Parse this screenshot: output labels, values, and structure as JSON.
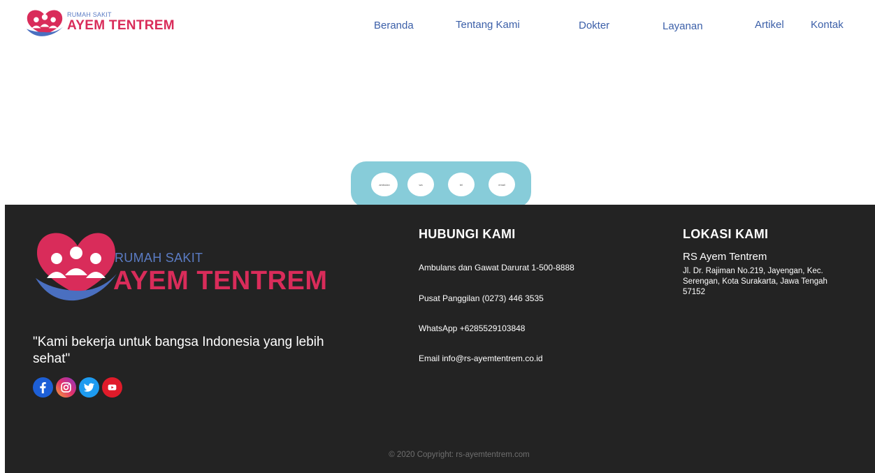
{
  "header": {
    "brand_small": "RUMAH SAKIT",
    "brand_big": "AYEM TENTREM"
  },
  "nav": {
    "items": [
      {
        "label": "Beranda"
      },
      {
        "label": "Tentang Kami"
      },
      {
        "label": "Dokter"
      },
      {
        "label": "Layanan"
      },
      {
        "label": "Artikel"
      },
      {
        "label": "Kontak"
      }
    ]
  },
  "pill": {
    "buttons": [
      {
        "label": "ambulan"
      },
      {
        "label": "wa"
      },
      {
        "label": "tel"
      },
      {
        "label": "email"
      }
    ]
  },
  "footer": {
    "brand_small": "RUMAH SAKIT",
    "brand_big": "AYEM TENTREM",
    "quote": "\"Kami bekerja untuk bangsa Indonesia yang lebih sehat\"",
    "socials": [
      "facebook-icon",
      "instagram-icon",
      "twitter-icon",
      "youtube-icon"
    ],
    "contact": {
      "title": "HUBUNGI KAMI",
      "lines": [
        "Ambulans dan Gawat Darurat 1-500-8888",
        "Pusat Panggilan (0273) 446 3535",
        "WhatsApp +6285529103848",
        "Email info@rs-ayemtentrem.co.id"
      ]
    },
    "location": {
      "title": "LOKASI KAMI",
      "name": "RS Ayem Tentrem",
      "address": "Jl. Dr. Rajiman No.219, Jayengan, Kec. Serengan, Kota Surakarta, Jawa Tengah 57152"
    },
    "copyright": "© 2020 Copyright: rs-ayemtentrem.com"
  },
  "colors": {
    "brand_pink": "#d92c5a",
    "brand_blue": "#5b7cc4",
    "nav_text": "#3b5fa8",
    "pill_bg": "#87ccd9",
    "footer_bg": "#232323"
  }
}
